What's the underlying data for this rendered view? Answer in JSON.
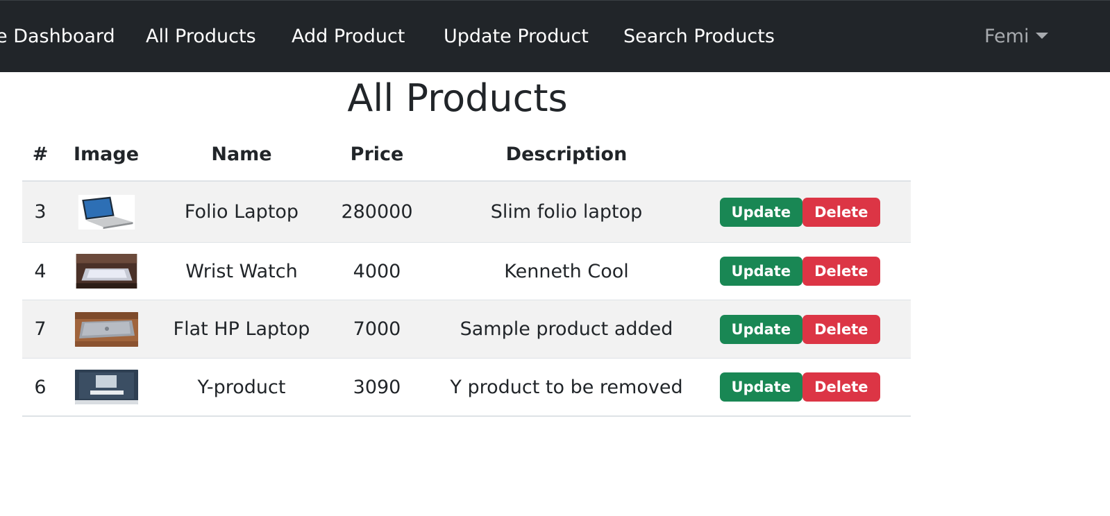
{
  "navbar": {
    "items": [
      {
        "label": "Dashboard",
        "prefix": "e "
      },
      {
        "label": "All Products"
      },
      {
        "label": "Add Product"
      },
      {
        "label": "Update Product"
      },
      {
        "label": "Search Products"
      }
    ],
    "user": "Femi",
    "colors": {
      "background": "#212529",
      "text": "#ffffff",
      "user_text": "#a8abaf"
    }
  },
  "page": {
    "title": "All Products"
  },
  "table": {
    "headers": [
      "#",
      "Image",
      "Name",
      "Price",
      "Description"
    ],
    "rows": [
      {
        "id": "3",
        "image": "laptop-photo",
        "name": "Folio Laptop",
        "price": "280000",
        "description": "Slim folio laptop",
        "update": "Update",
        "delete": "Delete"
      },
      {
        "id": "4",
        "image": "laptop-on-desk-photo",
        "name": "Wrist Watch",
        "price": "4000",
        "description": "Kenneth Cool",
        "update": "Update",
        "delete": "Delete"
      },
      {
        "id": "7",
        "image": "closed-laptop-photo",
        "name": "Flat HP Laptop",
        "price": "7000",
        "description": "Sample product added",
        "update": "Update",
        "delete": "Delete"
      },
      {
        "id": "6",
        "image": "congratulations-screen-photo",
        "name": "Y-product",
        "price": "3090",
        "description": "Y product to be removed",
        "update": "Update",
        "delete": "Delete"
      }
    ],
    "colors": {
      "success": "#198754",
      "danger": "#dc3545",
      "stripe": "#f2f2f2"
    }
  }
}
